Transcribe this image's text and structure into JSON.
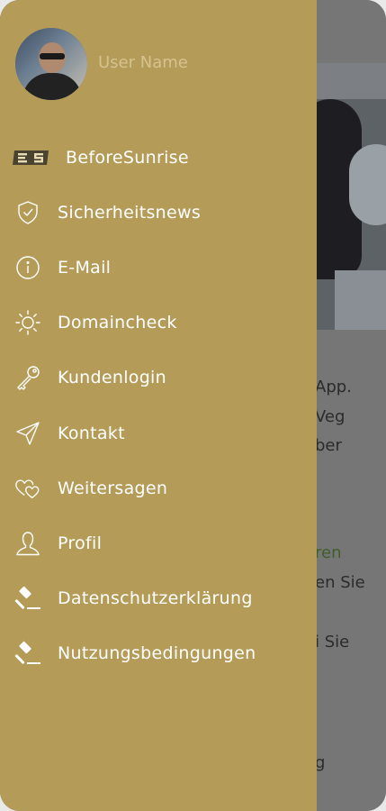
{
  "user": {
    "name": "User Name"
  },
  "menu": {
    "items": [
      {
        "label": "BeforeSunrise",
        "icon": "beforesunrise-logo-icon"
      },
      {
        "label": "Sicherheitsnews",
        "icon": "shield-check-icon"
      },
      {
        "label": "E-Mail",
        "icon": "info-circle-icon"
      },
      {
        "label": "Domaincheck",
        "icon": "sun-icon"
      },
      {
        "label": "Kundenlogin",
        "icon": "key-icon"
      },
      {
        "label": "Kontakt",
        "icon": "paper-plane-icon"
      },
      {
        "label": "Weitersagen",
        "icon": "hearts-icon"
      },
      {
        "label": "Profil",
        "icon": "user-icon"
      },
      {
        "label": "Datenschutzerklärung",
        "icon": "gavel-icon"
      },
      {
        "label": "Nutzungsbedingungen",
        "icon": "gavel-icon"
      }
    ]
  },
  "background": {
    "text_lines": [
      {
        "text": "App."
      },
      {
        "text": "Veg"
      },
      {
        "text": "ber"
      },
      {
        "text": "ren"
      },
      {
        "text": "en Sie"
      },
      {
        "text": "i Sie"
      },
      {
        "text": "g"
      }
    ]
  },
  "colors": {
    "drawer": "#b49c58",
    "drawer_text": "#ffffff",
    "username_text": "#d4c290",
    "overlay": "#767676"
  }
}
